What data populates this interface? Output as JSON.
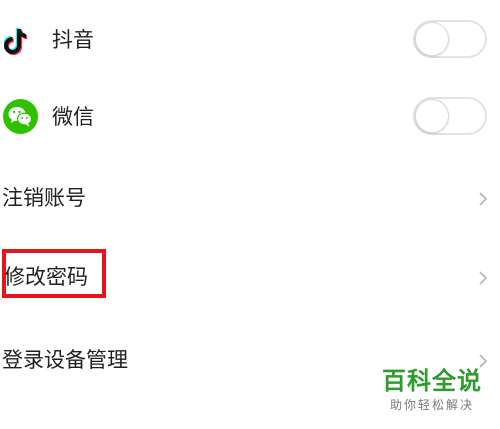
{
  "rows": {
    "douyin": {
      "label": "抖音",
      "icon": "douyin-icon",
      "toggle_on": false
    },
    "wechat": {
      "label": "微信",
      "icon": "wechat-icon",
      "toggle_on": false
    },
    "cancel_account": {
      "label": "注销账号",
      "icon": "chevron-right-icon"
    },
    "change_password": {
      "label": "修改密码",
      "icon": "chevron-right-icon",
      "highlight_color": "#e8131b"
    },
    "device_management": {
      "label": "登录设备管理",
      "icon": "chevron-right-icon"
    }
  },
  "watermark": {
    "main": "百科全说",
    "sub": "助你轻松解决",
    "color": "#2e9b2e"
  },
  "colors": {
    "wechat_green": "#2dc100",
    "toggle_border": "#e2e2e2",
    "chevron": "#b8b8b8"
  }
}
